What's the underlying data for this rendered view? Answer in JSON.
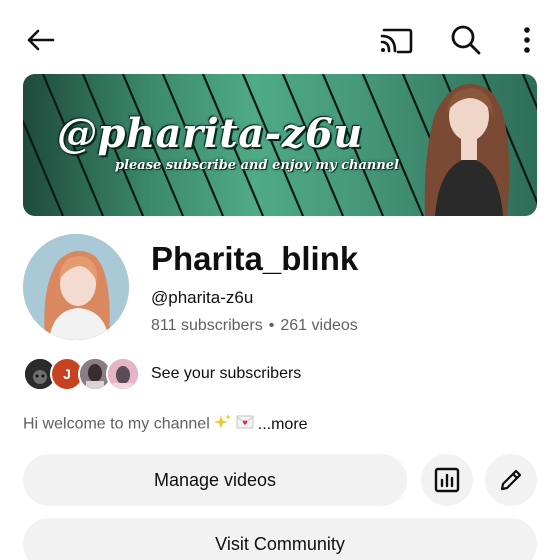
{
  "topbar": {
    "icons": [
      "back-arrow-icon",
      "cast-icon",
      "search-icon",
      "more-vert-icon"
    ]
  },
  "banner": {
    "handle_text": "@pharita-z6u",
    "tagline": "please subscribe and enjoy my channel",
    "colors": {
      "primary": "#3b8a6c",
      "dark": "#1f4a3c"
    }
  },
  "channel": {
    "name": "Pharita_blink",
    "handle": "@pharita-z6u",
    "subscribers": "811 subscribers",
    "separator": "•",
    "videos": "261 videos"
  },
  "subscribers_row": {
    "initial": "J",
    "label": "See your subscribers"
  },
  "description": {
    "text": "Hi welcome to my channel",
    "more": "...more"
  },
  "actions": {
    "manage_videos": "Manage videos",
    "visit_community": "Visit Community",
    "analytics_icon": "analytics-icon",
    "edit_icon": "pencil-icon"
  },
  "colors": {
    "text_primary": "#0f0f0f",
    "text_secondary": "#606060",
    "button_bg": "#f2f2f2"
  }
}
